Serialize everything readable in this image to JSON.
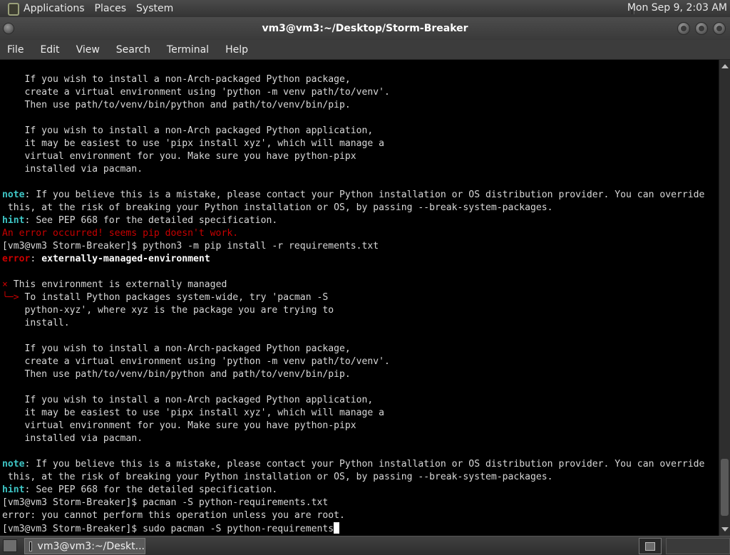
{
  "top_panel": {
    "applications": "Applications",
    "places": "Places",
    "system": "System",
    "clock": "Mon Sep  9,  2:03 AM"
  },
  "window": {
    "title": "vm3@vm3:~/Desktop/Storm-Breaker"
  },
  "menubar": [
    "File",
    "Edit",
    "View",
    "Search",
    "Terminal",
    "Help"
  ],
  "terminal": {
    "lines": [
      "    If you wish to install a non-Arch-packaged Python package,",
      "    create a virtual environment using 'python -m venv path/to/venv'.",
      "    Then use path/to/venv/bin/python and path/to/venv/bin/pip.",
      "",
      "    If you wish to install a non-Arch packaged Python application,",
      "    it may be easiest to use 'pipx install xyz', which will manage a",
      "    virtual environment for you. Make sure you have python-pipx",
      "    installed via pacman.",
      "",
      {
        "label": "note",
        "text": ": If you believe this is a mistake, please contact your Python installation or OS distribution provider. You can override"
      },
      " this, at the risk of breaking your Python installation or OS, by passing --break-system-packages.",
      {
        "label": "hint",
        "text": ": See PEP 668 for the detailed specification."
      },
      {
        "red": "An error occurred! seems pip doesn't work."
      },
      "[vm3@vm3 Storm-Breaker]$ python3 -m pip install -r requirements.txt",
      {
        "error": "error",
        "bold": "externally-managed-environment"
      },
      "",
      {
        "bullet": "×",
        "text": " This environment is externally managed"
      },
      {
        "bullet": "╰─>",
        "text": " To install Python packages system-wide, try 'pacman -S"
      },
      "    python-xyz', where xyz is the package you are trying to",
      "    install.",
      "",
      "    If you wish to install a non-Arch-packaged Python package,",
      "    create a virtual environment using 'python -m venv path/to/venv'.",
      "    Then use path/to/venv/bin/python and path/to/venv/bin/pip.",
      "",
      "    If you wish to install a non-Arch packaged Python application,",
      "    it may be easiest to use 'pipx install xyz', which will manage a",
      "    virtual environment for you. Make sure you have python-pipx",
      "    installed via pacman.",
      "",
      {
        "label": "note",
        "text": ": If you believe this is a mistake, please contact your Python installation or OS distribution provider. You can override"
      },
      " this, at the risk of breaking your Python installation or OS, by passing --break-system-packages.",
      {
        "label": "hint",
        "text": ": See PEP 668 for the detailed specification."
      },
      "[vm3@vm3 Storm-Breaker]$ pacman -S python-requirements.txt",
      "error: you cannot perform this operation unless you are root.",
      {
        "prompt": "[vm3@vm3 Storm-Breaker]$ sudo pacman -S python-requirements",
        "cursor": true
      }
    ]
  },
  "taskbar": {
    "task_label": "vm3@vm3:~/Deskt..."
  }
}
